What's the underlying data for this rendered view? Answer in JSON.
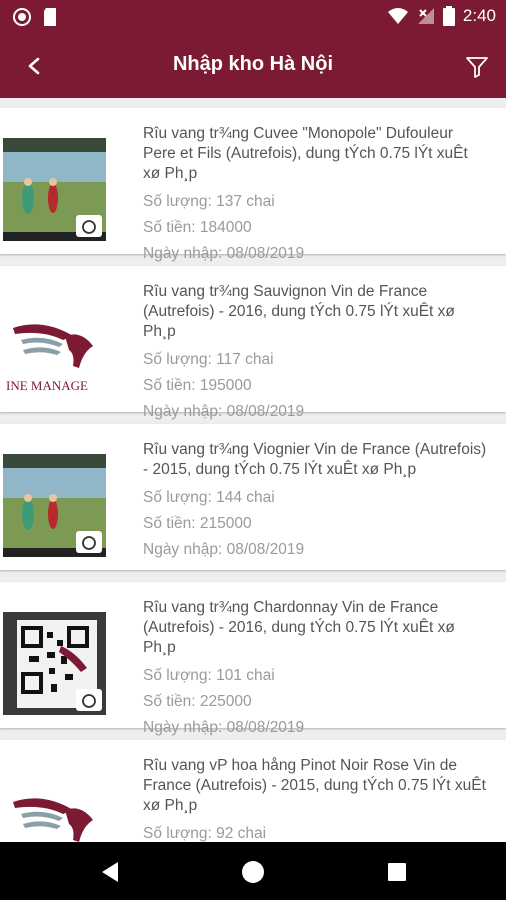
{
  "status_bar": {
    "time": "2:40"
  },
  "toolbar": {
    "title": "Nhập kho Hà Nội"
  },
  "labels": {
    "quantity": "Số lượng:",
    "amount": "Số tiền:",
    "date": "Ngày nhập:"
  },
  "logo_text": "INE MANAGE",
  "items": [
    {
      "name": "Rîu vang tr¾ng Cuvee \"Monopole\" Dufouleur Pere et Fils (Autrefois), dung tÝch 0.75 lÝt xuÊt xø Ph¸p",
      "quantity": "137 chai",
      "amount": "184000",
      "date": "08/08/2019",
      "thumb": "game-screenshot"
    },
    {
      "name": "Rîu vang tr¾ng Sauvignon Vin de France (Autrefois) - 2016, dung tÝch 0.75 lÝt xuÊt xø Ph¸p",
      "quantity": "117 chai",
      "amount": "195000",
      "date": "08/08/2019",
      "thumb": "logo"
    },
    {
      "name": "Rîu vang tr¾ng Viognier Vin de France (Autrefois) - 2015, dung tÝch 0.75 lÝt xuÊt xø Ph¸p",
      "quantity": "144 chai",
      "amount": "215000",
      "date": "08/08/2019",
      "thumb": "game-screenshot"
    },
    {
      "name": "Rîu vang tr¾ng Chardonnay Vin de France (Autrefois) - 2016, dung tÝch 0.75 lÝt xuÊt xø Ph¸p",
      "quantity": "101 chai",
      "amount": "225000",
      "date": "08/08/2019",
      "thumb": "qr-photo"
    },
    {
      "name": "Rîu vang vP hoa hång Pinot Noir Rose Vin de France (Autrefois) - 2015, dung tÝch 0.75 lÝt xuÊt xø Ph¸p",
      "quantity": "92 chai",
      "amount": "",
      "date": "",
      "thumb": "logo"
    }
  ],
  "colors": {
    "primary": "#7b1a32",
    "text": "#555555",
    "muted": "#9a9a9a"
  },
  "icons": [
    "back-arrow-icon",
    "filter-icon",
    "camera-icon",
    "wifi-icon",
    "battery-icon",
    "back-triangle-icon",
    "home-circle-icon",
    "recents-square-icon"
  ]
}
